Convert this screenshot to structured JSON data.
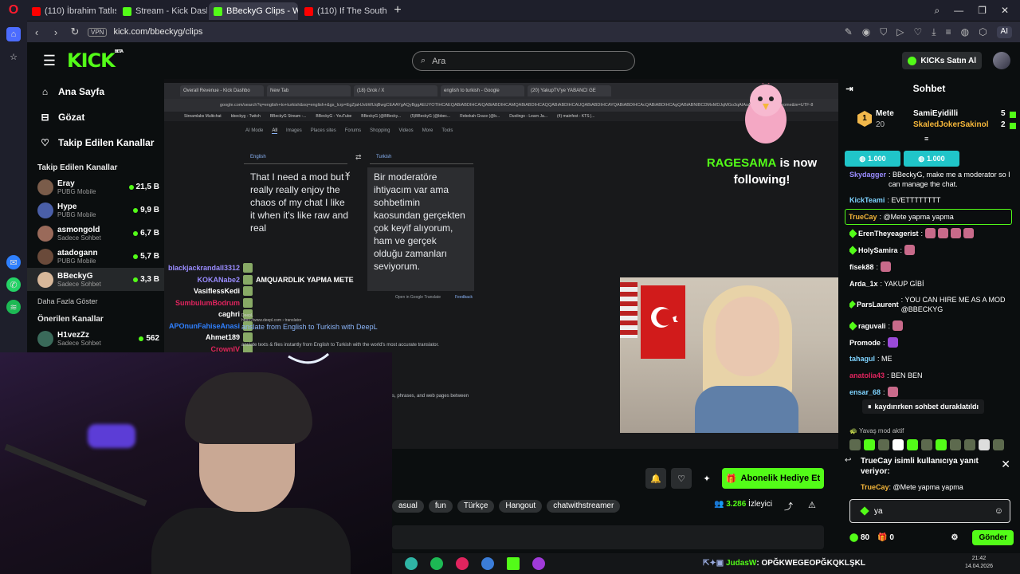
{
  "browser": {
    "tabs": [
      {
        "label": "(110) İbrahim Tatlıses - Sa",
        "color": "#ff0000",
        "active": false
      },
      {
        "label": "Stream - Kick Dashboard",
        "color": "#53fc18",
        "active": false
      },
      {
        "label": "BBeckyG Clips - Watc",
        "color": "#53fc18",
        "active": true
      },
      {
        "label": "(110) If The South Woulda",
        "color": "#ff0000",
        "active": false
      }
    ],
    "url": "kick.com/bbeckyg/clips",
    "vpn": "VPN",
    "ai": "AI"
  },
  "header": {
    "logo": "KICK",
    "logo_badge": "BETA",
    "search_placeholder": "Ara",
    "buy_kicks": "KICKs Satın Al"
  },
  "sidebar": {
    "nav": [
      {
        "label": "Ana Sayfa",
        "icon": "home-icon"
      },
      {
        "label": "Gözat",
        "icon": "browse-icon"
      },
      {
        "label": "Takip Edilen Kanallar",
        "icon": "heart-icon"
      }
    ],
    "followed_title": "Takip Edilen Kanallar",
    "channels": [
      {
        "name": "Eray",
        "category": "PUBG Mobile",
        "viewers": "21,5 B",
        "color": "#7a5c4a"
      },
      {
        "name": "Hype",
        "category": "PUBG Mobile",
        "viewers": "9,9 B",
        "color": "#4a5fa8"
      },
      {
        "name": "asmongold",
        "category": "Sadece Sohbet",
        "viewers": "6,7 B",
        "color": "#9a6a5a"
      },
      {
        "name": "atadogann",
        "category": "PUBG Mobile",
        "viewers": "5,7 B",
        "color": "#6a4a3a"
      },
      {
        "name": "BBeckyG",
        "category": "Sadece Sohbet",
        "viewers": "3,3 B",
        "color": "#d8b89a"
      }
    ],
    "show_more": "Daha Fazla Göster",
    "recommended_title": "Önerilen Kanallar",
    "recommended": [
      {
        "name": "H1vezZz",
        "category": "Sadece Sohbet",
        "viewers": "562",
        "color": "#3a6a5a"
      }
    ]
  },
  "stream": {
    "ss_tabs": [
      "Overall Revenue - Kick Dashbo",
      "New Tab",
      "(18) Grok / X",
      "english to turkish - Google",
      "(20) YakupTV'ye YABANCI GE"
    ],
    "ss_url": "google.com/search?q=english+to+turkish&oq=english+&gs_lcrp=EgZjaHJvbWUqBwgCEAAYgAQyBggAEUYOTIHCAEQABiABDIHCAIQABiABDIHCAMQABiABDIHCAQQABiABDIHCAUQABiABDIHCAYQABiABDIHCAcQABiABDIHCAgQABiABNIBCDMxMDJqMGo3qAIAsAIA&sourceid=chrome&ie=UTF-8",
    "ss_bookmarks": [
      "Streamlabs Multichat",
      "bbeckyg - Twitch",
      "BBeckyG Stream -...",
      "BBeckyG - YouTube",
      "BBeckyG (@BBecky...",
      "(5)BBeckyG (@bbec...",
      "Rebekah Grace (@b...",
      "Duolingo - Learn Ja...",
      "(4) mainfest - KTS |..."
    ],
    "ss_google_tabs": [
      "AI Mode",
      "All",
      "Images",
      "Places sites",
      "Forums",
      "Shopping",
      "Videos",
      "More",
      "Tools"
    ],
    "lang_from": "English",
    "lang_to": "Turkish",
    "source_text": "That I need a mod but I really really enjoy the chaos of my chat I like it when it's like raw and real",
    "translated_text": "Bir moderatöre ihtiyacım var ama sohbetimin kaosundan gerçekten çok keyif alıyorum, ham ve gerçek olduğu zamanları seviyorum.",
    "open_translate": "Open in Google Translate",
    "feedback": "Feedback",
    "ss_chat": [
      {
        "user": "blackjackrandall3312",
        "color": "#9a8cff",
        "text": ""
      },
      {
        "user": "KOKANabe2",
        "color": "#9a8cff",
        "text": "AMQUARDLIK YAPMA METE"
      },
      {
        "user": "VasiflessKedi",
        "color": "#ffffff",
        "text": ""
      },
      {
        "user": "SumbulumBodrum",
        "color": "#e0245e",
        "text": ""
      },
      {
        "user": "caghri",
        "color": "#ffffff",
        "text": ""
      },
      {
        "user": "APOnunFahiseAnasi",
        "color": "#2f80ff",
        "text": ""
      },
      {
        "user": "Ahmet189",
        "color": "#ffffff",
        "text": ""
      },
      {
        "user": "CrownIV",
        "color": "#e0245e",
        "text": ""
      }
    ],
    "deepl_site": "DeepL",
    "deepl_url": "https://www.deepl.com › translator",
    "deepl_title": "anslate from English to Turkish with DeepL",
    "deepl_desc": "anslate texts & files instantly from English to Turkish with the world's most accurate translator.",
    "phrases_text": "s, phrases, and web pages between",
    "alert_user": "RAGESAMA",
    "alert_text": "is now following!"
  },
  "below": {
    "gift_sub": "Abonelik Hediye Et",
    "tags": [
      "asual",
      "fun",
      "Türkçe",
      "Hangout",
      "chatwithstreamer"
    ],
    "viewers": "3.286",
    "viewers_label": "İzleyici"
  },
  "taskbar": {
    "ticker_user": "JudasW",
    "ticker_text": ": OPĞKWEGEOPĞKQKLŞKL",
    "time": "21:42",
    "date": "14.04.2026"
  },
  "chat": {
    "title": "Sohbet",
    "leaderboard": {
      "top_user": "Mete",
      "top_count": "20",
      "users": [
        {
          "name": "SamiEyidilli",
          "count": "5",
          "color": "#ffffff"
        },
        {
          "name": "SkaledJokerSakinol",
          "count": "2",
          "color": "#f5b63a"
        }
      ]
    },
    "pinned": [
      "1.000",
      "1.000"
    ],
    "messages": [
      {
        "user": "Skydagger",
        "color": "#9a8cff",
        "text": ": BBeckyG, make me a moderator so I can manage the chat."
      },
      {
        "user": "KickTeami",
        "color": "#7ed3ff",
        "text": ": EVETTTTTTTT"
      },
      {
        "user": "TrueCay",
        "color": "#f5b63a",
        "text": ": @Mete yapma yapma",
        "highlight": true
      },
      {
        "user": "ErenTheyeagerist",
        "color": "#53fc18",
        "text": ":"
      },
      {
        "user": "HolySamira",
        "color": "#53fc18",
        "text": ":"
      },
      {
        "user": "fisek88",
        "color": "#ffffff",
        "text": ":"
      },
      {
        "user": "Arda_1x",
        "color": "#ffffff",
        "text": ": YAKUP GİBİ"
      },
      {
        "user": "ParsLaurent",
        "color": "#53fc18",
        "text": ": YOU CAN HIRE ME AS A MOD @BBECKYG"
      },
      {
        "user": "raguvali",
        "color": "#53fc18",
        "text": ":"
      },
      {
        "user": "Promode",
        "color": "#ffffff",
        "text": ":"
      },
      {
        "user": "tahagul",
        "color": "#7ed3ff",
        "text": ": ME"
      },
      {
        "user": "anatolia43",
        "color": "#e0245e",
        "text": ": BEN BEN"
      },
      {
        "user": "ensar_68",
        "color": "#7ed3ff",
        "text": ":"
      }
    ],
    "paused": "kaydırırken sohbet duraklatıldı",
    "slow_mode": "Yavaş mod aktif",
    "reply_title": "TrueCay isimli kullanıcıya yanıt veriyor:",
    "reply_user": "TrueCay",
    "reply_text": ": @Mete yapma yapma",
    "input_value": "ya",
    "points": "80",
    "gifts": "0",
    "send": "Gönder"
  }
}
